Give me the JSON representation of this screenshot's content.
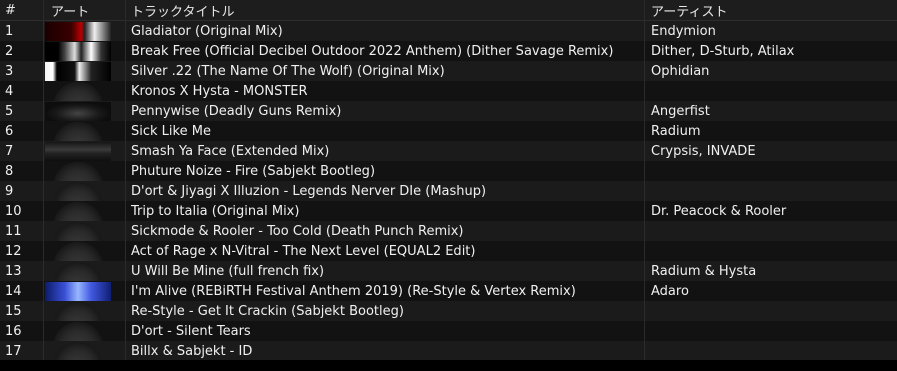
{
  "columns": {
    "num": "#",
    "art": "アート",
    "title": "トラックタイトル",
    "artist": "アーティスト"
  },
  "rows": [
    {
      "num": "1",
      "title": "Gladiator (Original Mix)",
      "artist": "Endymion",
      "art": "dark1"
    },
    {
      "num": "2",
      "title": "Break Free (Official Decibel Outdoor 2022 Anthem) (Dither Savage Remix)",
      "artist": "Dither, D-Sturb, Atilax",
      "art": "dark2"
    },
    {
      "num": "3",
      "title": "Silver .22 (The Name Of The Wolf) (Original Mix)",
      "artist": "Ophidian",
      "art": "dark3"
    },
    {
      "num": "4",
      "title": "Kronos X Hysta - MONSTER",
      "artist": "",
      "art": "empty"
    },
    {
      "num": "5",
      "title": "Pennywise (Deadly Guns Remix)",
      "artist": "Angerfist",
      "art": "dark4"
    },
    {
      "num": "6",
      "title": "Sick Like Me",
      "artist": "Radium",
      "art": "empty"
    },
    {
      "num": "7",
      "title": "Smash Ya Face (Extended Mix)",
      "artist": "Crypsis, INVADE",
      "art": "dark5"
    },
    {
      "num": "8",
      "title": "Phuture Noize - Fire (Sabjekt Bootleg)",
      "artist": "",
      "art": "empty"
    },
    {
      "num": "9",
      "title": "D'ort & Jiyagi X Illuzion - Legends Nerver DIe (Mashup)",
      "artist": "",
      "art": "empty"
    },
    {
      "num": "10",
      "title": "Trip to Italia (Original Mix)",
      "artist": "Dr. Peacock & Rooler",
      "art": "empty"
    },
    {
      "num": "11",
      "title": "Sickmode & Rooler - Too Cold (Death Punch Remix)",
      "artist": "",
      "art": "empty"
    },
    {
      "num": "12",
      "title": "Act of Rage x N-Vitral - The Next Level (EQUAL2 Edit)",
      "artist": "",
      "art": "empty"
    },
    {
      "num": "13",
      "title": "U Will Be Mine (full french fix)",
      "artist": "Radium & Hysta",
      "art": "empty"
    },
    {
      "num": "14",
      "title": "I'm Alive (REBiRTH Festival Anthem 2019) (Re-Style & Vertex Remix)",
      "artist": "Adaro",
      "art": "blue"
    },
    {
      "num": "15",
      "title": "Re-Style -  Get It Crackin (Sabjekt Bootleg)",
      "artist": "",
      "art": "empty"
    },
    {
      "num": "16",
      "title": "D'ort - Silent Tears",
      "artist": "",
      "art": "empty"
    },
    {
      "num": "17",
      "title": "Billx & Sabjekt - ID",
      "artist": "",
      "art": "empty"
    }
  ]
}
